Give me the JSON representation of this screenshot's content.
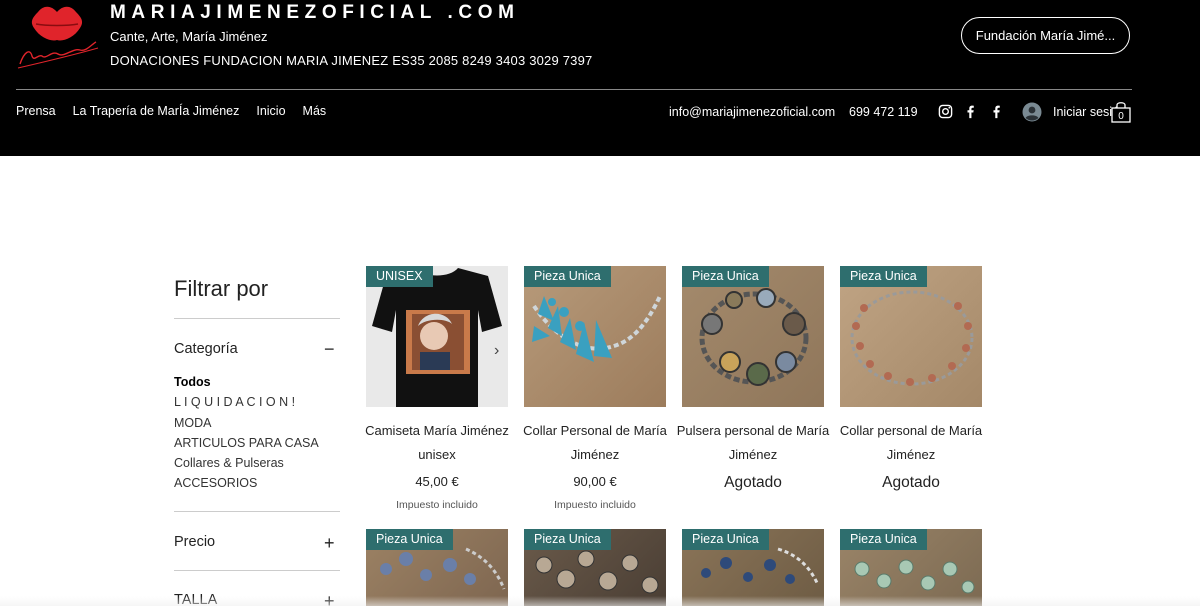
{
  "header": {
    "site_title": "MARIAJIMENEZOFICIAL .COM",
    "subtitle": "Cante, Arte, María Jiménez",
    "donation": "DONACIONES FUNDACION MARIA JIMENEZ  ES35 2085 8249 3403 3029 7397",
    "fund_button": "Fundación María Jimé...",
    "nav": [
      "Prensa",
      "La Trapería de MarÍa Jiménez",
      "Inicio",
      "Más"
    ],
    "email": "info@mariajimenezoficial.com",
    "phone": "699 472 119",
    "social_icons": [
      "instagram-icon",
      "facebook-icon",
      "facebook-icon"
    ],
    "login": "Iniciar sesión",
    "cart_count": "0",
    "logo_signature": "María Jiménez"
  },
  "filter": {
    "title": "Filtrar por",
    "category_label": "Categoría",
    "category_toggle": "−",
    "categories": [
      "Todos",
      "L I Q U I D A C I O N !",
      "MODA",
      "ARTICULOS PARA CASA",
      "Collares & Pulseras",
      "ACCESORIOS"
    ],
    "price_label": "Precio",
    "price_toggle": "+",
    "size_label": "TALLA",
    "size_toggle": "+"
  },
  "products": [
    {
      "ribbon": "UNISEX",
      "name": "Camiseta María Jiménez unisex",
      "price": "45,00 €",
      "tax": "Impuesto incluido",
      "sold_out": ""
    },
    {
      "ribbon": "Pieza Unica",
      "name": "Collar Personal de María Jiménez",
      "price": "90,00 €",
      "tax": "Impuesto incluido",
      "sold_out": ""
    },
    {
      "ribbon": "Pieza Unica",
      "name": "Pulsera personal de María Jiménez",
      "price": "",
      "tax": "",
      "sold_out": "Agotado"
    },
    {
      "ribbon": "Pieza Unica",
      "name": "Collar personal de María Jiménez",
      "price": "",
      "tax": "",
      "sold_out": "Agotado"
    },
    {
      "ribbon": "Pieza Unica",
      "name": "",
      "price": "",
      "tax": "",
      "sold_out": ""
    },
    {
      "ribbon": "Pieza Unica",
      "name": "",
      "price": "",
      "tax": "",
      "sold_out": ""
    },
    {
      "ribbon": "Pieza Unica",
      "name": "",
      "price": "",
      "tax": "",
      "sold_out": ""
    },
    {
      "ribbon": "Pieza Unica",
      "name": "",
      "price": "",
      "tax": "",
      "sold_out": ""
    }
  ],
  "colors": {
    "header_bg": "#000000",
    "ribbon": "#2e6e6e",
    "logo_red": "#e0242b"
  }
}
